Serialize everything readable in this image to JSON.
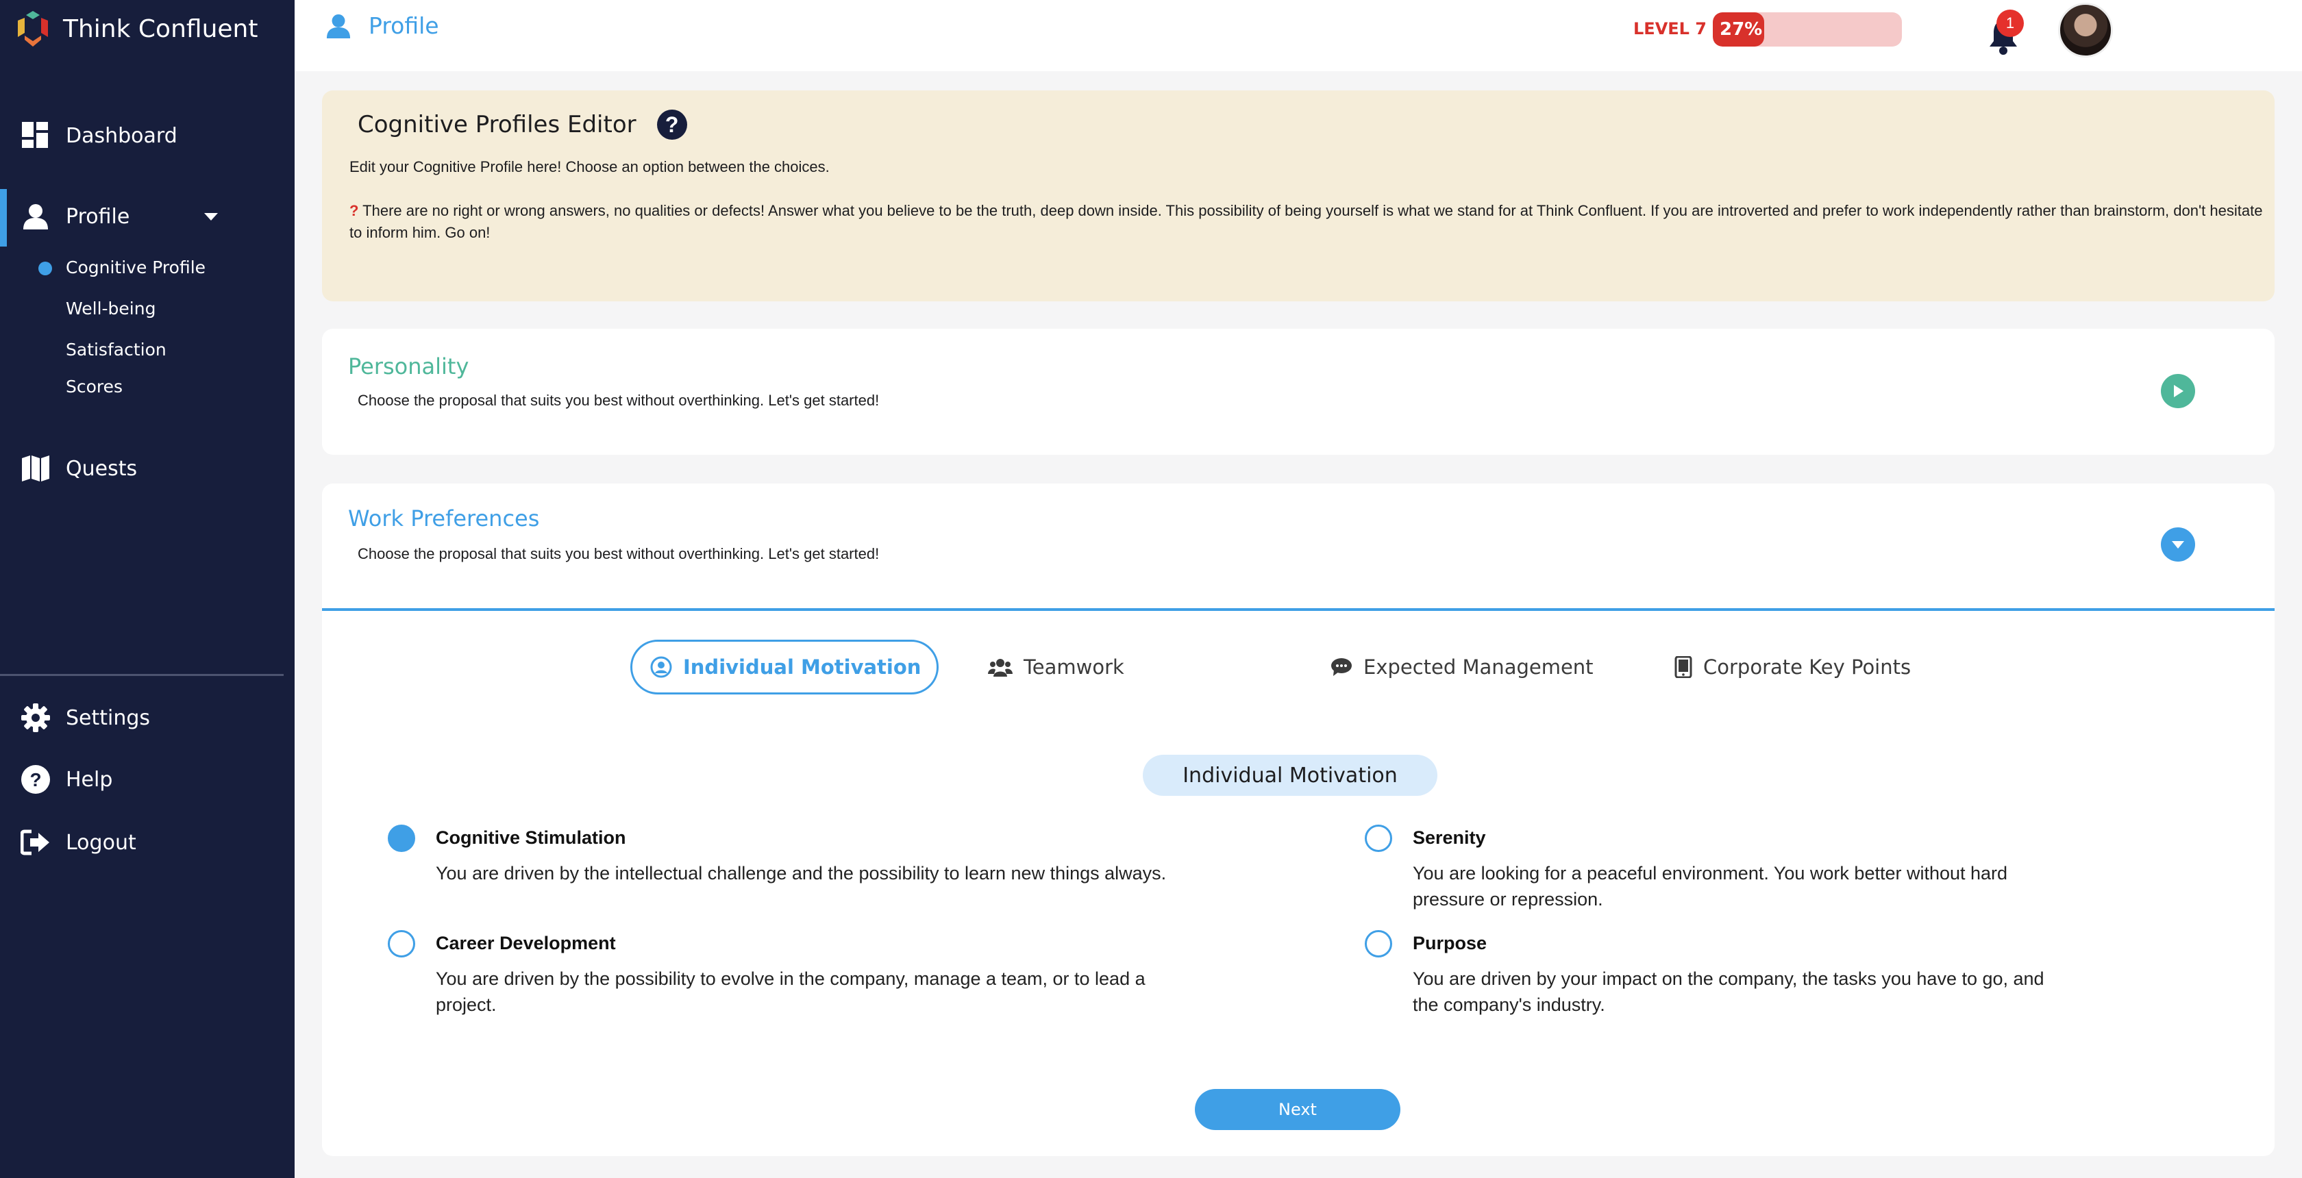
{
  "brand": {
    "name": "Think Confluent"
  },
  "sidebar": {
    "items": [
      {
        "label": "Dashboard",
        "icon": "dashboard-icon"
      },
      {
        "label": "Profile",
        "icon": "user-icon"
      },
      {
        "label": "Quests",
        "icon": "map-icon"
      }
    ],
    "profile_subitems": [
      {
        "label": "Cognitive Profile",
        "active": true
      },
      {
        "label": "Well-being"
      },
      {
        "label": "Satisfaction"
      },
      {
        "label": "Scores"
      }
    ],
    "bottom_items": [
      {
        "label": "Settings",
        "icon": "gear-icon"
      },
      {
        "label": "Help",
        "icon": "help-icon"
      },
      {
        "label": "Logout",
        "icon": "logout-icon"
      }
    ]
  },
  "header": {
    "title": "Profile",
    "level_label": "LEVEL 7",
    "progress_text": "27%",
    "progress_value": 0.27,
    "notification_count": "1"
  },
  "editor": {
    "title": "Cognitive Profiles Editor",
    "help_glyph": "?",
    "intro": "Edit your Cognitive Profile here! Choose an option between the choices.",
    "note_mark": "?",
    "note": "There are no right or wrong answers, no qualities or defects! Answer what you believe to be the truth, deep down inside. This possibility of being yourself is what we stand for at Think Confluent. If you are introverted and prefer to work independently rather than brainstorm, don't hesitate to inform him. Go on!"
  },
  "sections": {
    "personality": {
      "title": "Personality",
      "subtitle": "Choose the proposal that suits you best without overthinking. Let's get started!"
    },
    "work_preferences": {
      "title": "Work Preferences",
      "subtitle": "Choose the proposal that suits you best without overthinking. Let's get started!"
    }
  },
  "tabs": [
    {
      "label": "Individual Motivation",
      "icon": "user-circle-icon",
      "active": true
    },
    {
      "label": "Teamwork",
      "icon": "users-icon"
    },
    {
      "label": "Expected Management",
      "icon": "comments-icon"
    },
    {
      "label": "Corporate Key Points",
      "icon": "tablet-icon"
    }
  ],
  "question": {
    "heading": "Individual Motivation",
    "options": [
      {
        "title": "Cognitive Stimulation",
        "desc": "You are driven by the intellectual challenge and the possibility to learn new things always.",
        "selected": true
      },
      {
        "title": "Serenity",
        "desc": "You are looking for a peaceful environment. You work better without hard pressure or repression.",
        "selected": false
      },
      {
        "title": "Career Development",
        "desc": "You are driven by the possibility to evolve in the company, manage a team, or to lead a project.",
        "selected": false
      },
      {
        "title": "Purpose",
        "desc": "You are driven by your impact on the company, the tasks you have to go, and the company's industry.",
        "selected": false
      }
    ]
  },
  "actions": {
    "next_label": "Next"
  },
  "colors": {
    "sidebar": "#171e3c",
    "accent": "#3f9fe6",
    "teal": "#4fb79a",
    "level_red": "#d8312b",
    "info_bg": "#f5edd9"
  }
}
